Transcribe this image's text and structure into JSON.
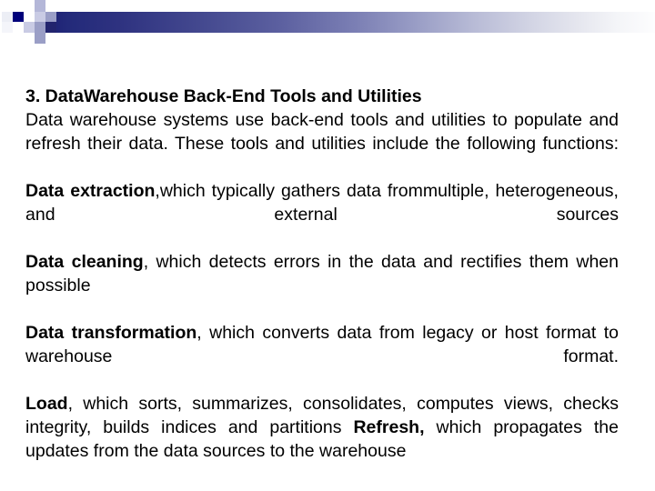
{
  "slide": {
    "decoration": {
      "name": "header-gradient-bar",
      "gradient_start_color": "#191970",
      "gradient_end_color": "#ffffff",
      "accent_square_dark": "#00007a",
      "accent_square_mid": "#9a9ec6",
      "accent_square_light": "#c9cbe4"
    },
    "heading": "3. Data Warehouse Back-End Tools and Utilities",
    "heading_display": "3. DataWarehouse Back-End Tools and Utilities",
    "intro": {
      "text": "Data warehouse systems use back-end tools and utilities to populate and refresh their data. These tools and utilities include the following functions:"
    },
    "items": [
      {
        "term": "Data extraction",
        "rest": ",which typically gathers data frommultiple, heterogeneous, and external sources"
      },
      {
        "term": "Data cleaning",
        "rest": ", which detects errors in the data and rectifies them when possible"
      },
      {
        "term": "Data transformation",
        "rest": ", which converts data from legacy or host format to warehouse format."
      },
      {
        "term": "Load",
        "rest_before": ", which sorts, summarizes, consolidates, computes views, checks integrity, builds indices and partitions ",
        "term2": "Refresh,",
        "rest_after": " which propagates the updates from the data sources to the warehouse"
      }
    ]
  }
}
